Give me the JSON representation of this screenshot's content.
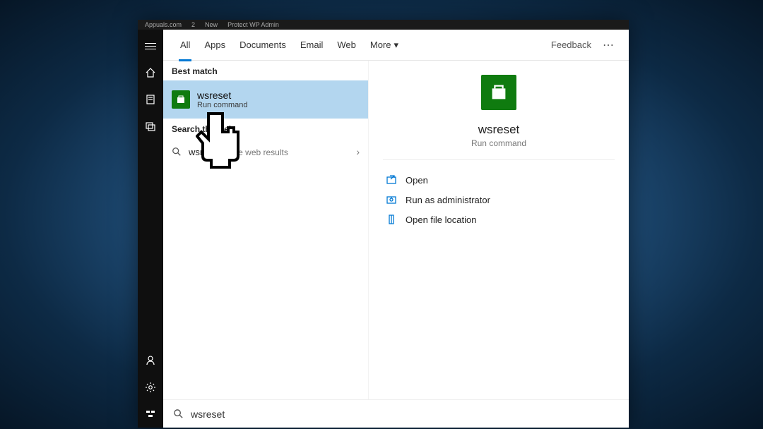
{
  "browser_bar": {
    "items": [
      "Appuals.com",
      "2",
      "New",
      "Protect WP Admin"
    ]
  },
  "tabs": {
    "all": "All",
    "apps": "Apps",
    "documents": "Documents",
    "email": "Email",
    "web": "Web",
    "more": "More",
    "feedback": "Feedback"
  },
  "sections": {
    "best_match": "Best match",
    "search_web": "Search the web"
  },
  "best_match": {
    "title": "wsreset",
    "subtitle": "Run command"
  },
  "web_result": {
    "query": "wsreset",
    "suffix": " - See web results"
  },
  "detail": {
    "title": "wsreset",
    "subtitle": "Run command"
  },
  "actions": {
    "open": "Open",
    "run_admin": "Run as administrator",
    "open_loc": "Open file location"
  },
  "search": {
    "query": "wsreset"
  }
}
